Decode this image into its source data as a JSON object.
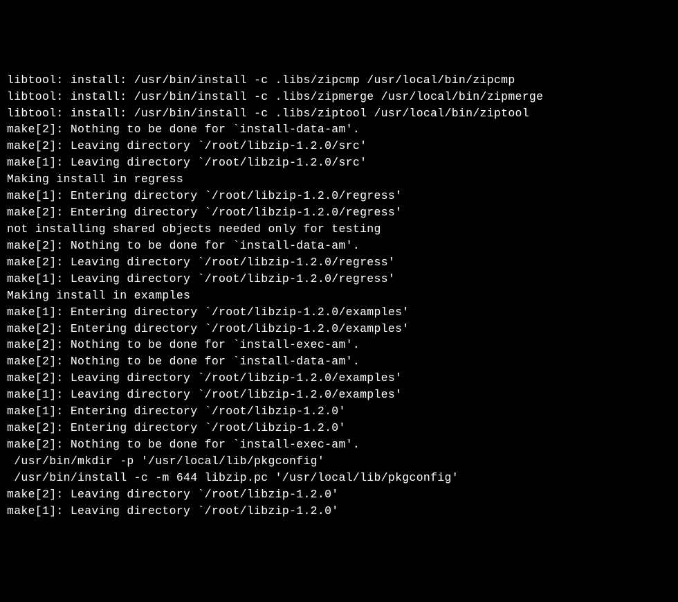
{
  "terminal": {
    "lines": [
      "libtool: install: /usr/bin/install -c .libs/zipcmp /usr/local/bin/zipcmp",
      "libtool: install: /usr/bin/install -c .libs/zipmerge /usr/local/bin/zipmerge",
      "libtool: install: /usr/bin/install -c .libs/ziptool /usr/local/bin/ziptool",
      "make[2]: Nothing to be done for `install-data-am'.",
      "make[2]: Leaving directory `/root/libzip-1.2.0/src'",
      "make[1]: Leaving directory `/root/libzip-1.2.0/src'",
      "Making install in regress",
      "make[1]: Entering directory `/root/libzip-1.2.0/regress'",
      "make[2]: Entering directory `/root/libzip-1.2.0/regress'",
      "not installing shared objects needed only for testing",
      "make[2]: Nothing to be done for `install-data-am'.",
      "make[2]: Leaving directory `/root/libzip-1.2.0/regress'",
      "make[1]: Leaving directory `/root/libzip-1.2.0/regress'",
      "Making install in examples",
      "make[1]: Entering directory `/root/libzip-1.2.0/examples'",
      "make[2]: Entering directory `/root/libzip-1.2.0/examples'",
      "make[2]: Nothing to be done for `install-exec-am'.",
      "make[2]: Nothing to be done for `install-data-am'.",
      "make[2]: Leaving directory `/root/libzip-1.2.0/examples'",
      "make[1]: Leaving directory `/root/libzip-1.2.0/examples'",
      "make[1]: Entering directory `/root/libzip-1.2.0'",
      "make[2]: Entering directory `/root/libzip-1.2.0'",
      "make[2]: Nothing to be done for `install-exec-am'.",
      " /usr/bin/mkdir -p '/usr/local/lib/pkgconfig'",
      " /usr/bin/install -c -m 644 libzip.pc '/usr/local/lib/pkgconfig'",
      "make[2]: Leaving directory `/root/libzip-1.2.0'",
      "make[1]: Leaving directory `/root/libzip-1.2.0'"
    ]
  }
}
